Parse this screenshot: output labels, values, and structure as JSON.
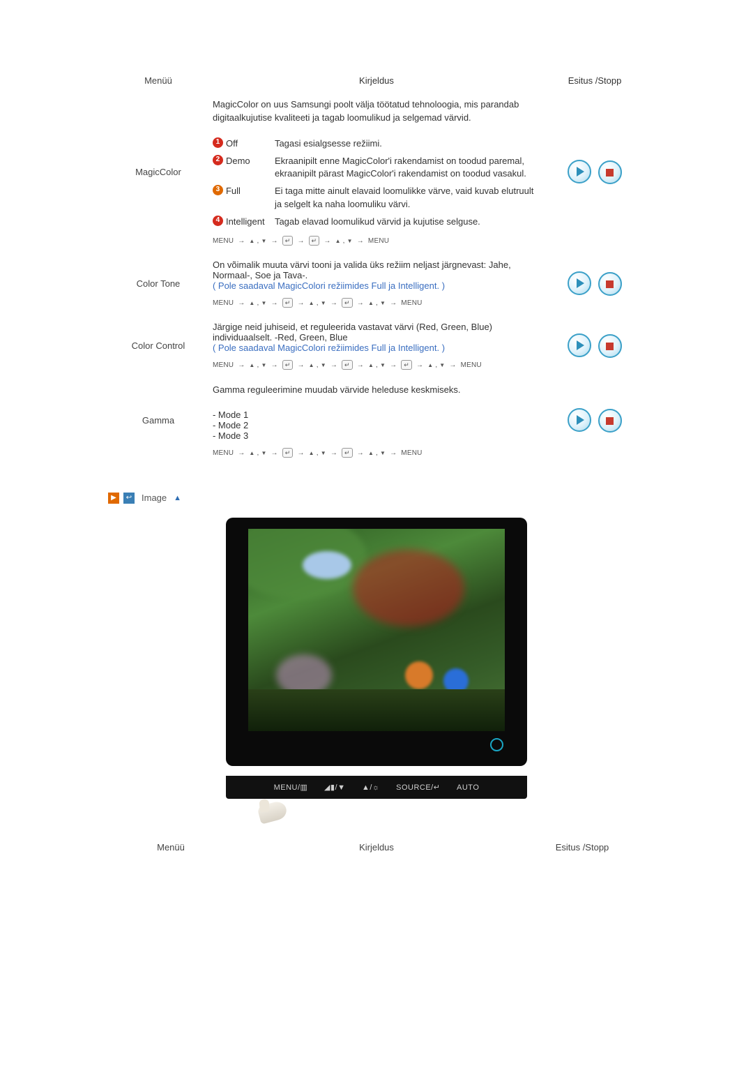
{
  "header": {
    "menu": "Menüü",
    "desc": "Kirjeldus",
    "action": "Esitus /Stopp"
  },
  "rows": {
    "magiccolor": {
      "name": "MagicColor",
      "intro": "MagicColor on uus Samsungi poolt välja töötatud tehnoloogia, mis parandab digitaalkujutise kvaliteeti ja tagab loomulikud ja selgemad värvid.",
      "opts": {
        "o1": {
          "n": "1",
          "label": "Off",
          "text": "Tagasi esialgsesse režiimi."
        },
        "o2": {
          "n": "2",
          "label": "Demo",
          "text": "Ekraanipilt enne MagicColor'i rakendamist on toodud paremal, ekraanipilt pärast MagicColor'i rakendamist on toodud vasakul."
        },
        "o3": {
          "n": "3",
          "label": "Full",
          "text": "Ei taga mitte ainult elavaid loomulikke värve, vaid kuvab elutruult ja selgelt ka naha loomuliku värvi."
        },
        "o4": {
          "n": "4",
          "label": "Intelligent",
          "text": "Tagab elavad loomulikud värvid ja kujutise selguse."
        }
      },
      "seq": "MENU → ▲ , ▼ → ↵ → ↵ → ▲ , ▼ → MENU"
    },
    "colortone": {
      "name": "Color Tone",
      "text": "On võimalik muuta värvi tooni ja valida üks režiim neljast järgnevast: Jahe, Normaal-, Soe ja Tava-.",
      "note": "( Pole saadaval MagicColori režiimides Full ja Intelligent. )",
      "seq": "MENU → ▲ , ▼ → ↵ → ▲ , ▼ → ↵ → ▲ , ▼ → MENU"
    },
    "colorcontrol": {
      "name": "Color Control",
      "text": "Järgige neid juhiseid, et reguleerida vastavat värvi (Red, Green, Blue) individuaalselt. -Red, Green, Blue",
      "note": "( Pole saadaval MagicColori režiimides Full ja Intelligent. )",
      "seq": "MENU → ▲ , ▼ → ↵ → ▲ , ▼ → ↵ → ▲ , ▼ → ↵ → ▲ , ▼ → MENU"
    },
    "gamma": {
      "name": "Gamma",
      "text": "Gamma reguleerimine muudab värvide heleduse keskmiseks.",
      "m1": "- Mode 1",
      "m2": "- Mode 2",
      "m3": "- Mode 3",
      "seq": "MENU → ▲ , ▼ → ↵ → ▲ , ▼ → ↵ → ▲ , ▼ → MENU"
    }
  },
  "section": {
    "image": "Image"
  },
  "btnbar": {
    "b1": "MENU/▥",
    "b2": "◢▮/▼",
    "b3": "▲/☼",
    "b4": "SOURCE/↵",
    "b5": "AUTO"
  },
  "footer": {
    "menu": "Menüü",
    "desc": "Kirjeldus",
    "action": "Esitus /Stopp"
  }
}
